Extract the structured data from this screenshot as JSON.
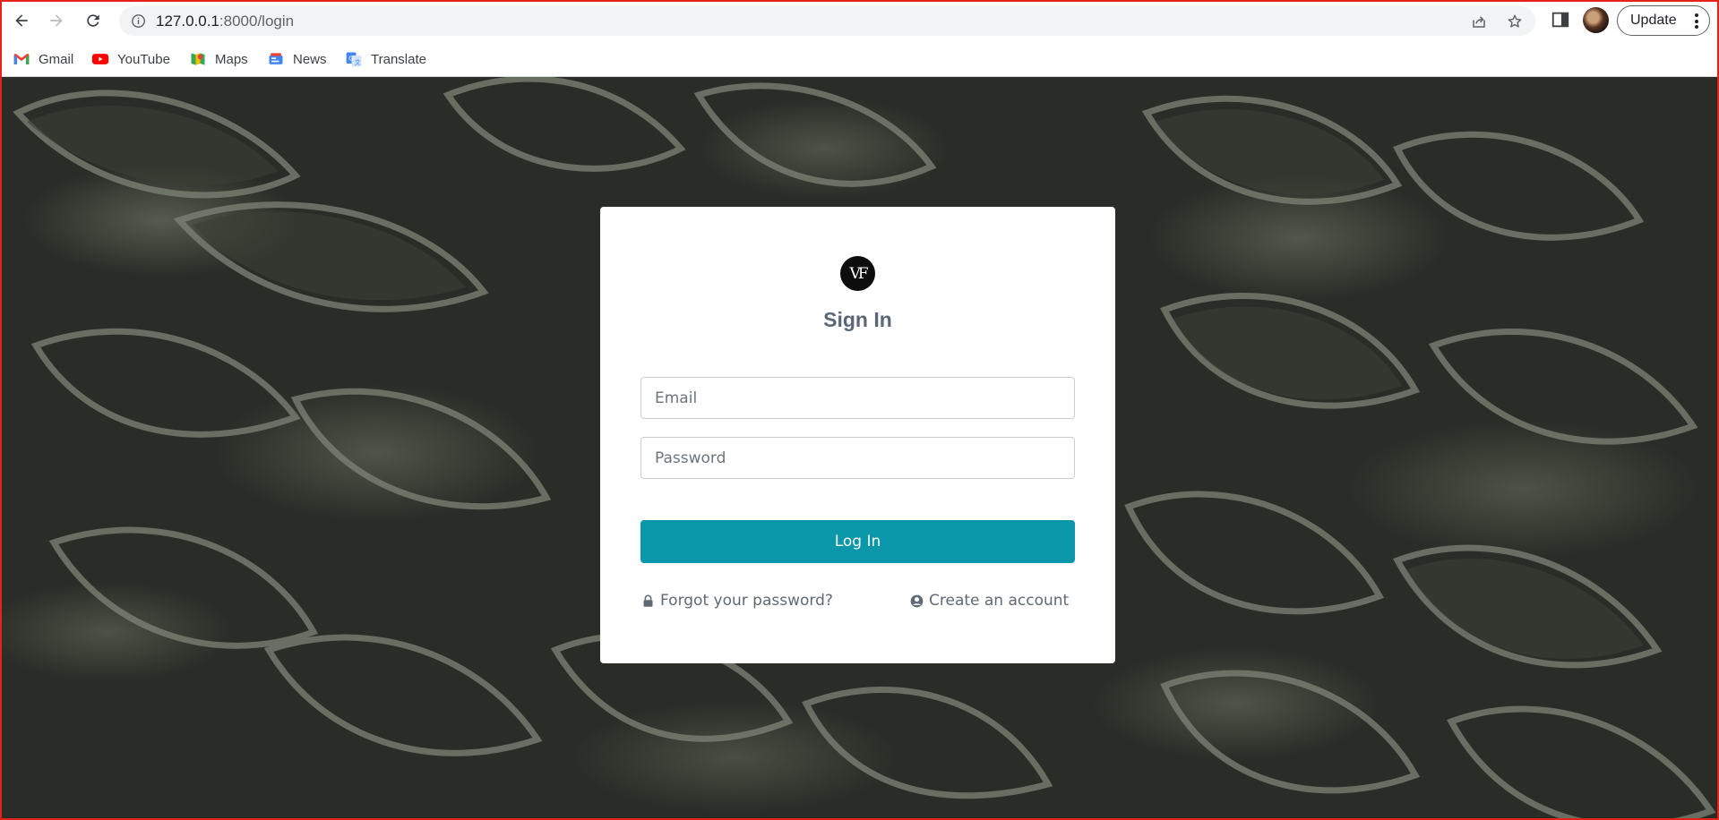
{
  "browser": {
    "url_host": "127.0.0.1",
    "url_rest": ":8000/login",
    "update_label": "Update",
    "bookmarks": [
      {
        "label": "Gmail",
        "icon": "gmail-icon"
      },
      {
        "label": "YouTube",
        "icon": "youtube-icon"
      },
      {
        "label": "Maps",
        "icon": "maps-icon"
      },
      {
        "label": "News",
        "icon": "news-icon"
      },
      {
        "label": "Translate",
        "icon": "translate-icon"
      }
    ]
  },
  "login": {
    "logo_text": "VF",
    "title": "Sign In",
    "email_placeholder": "Email",
    "password_placeholder": "Password",
    "submit_label": "Log In",
    "forgot_label": "Forgot your password?",
    "create_label": "Create an account"
  },
  "colors": {
    "accent": "#0a97a9",
    "title": "#5a6776",
    "window_border": "#e3231a"
  }
}
